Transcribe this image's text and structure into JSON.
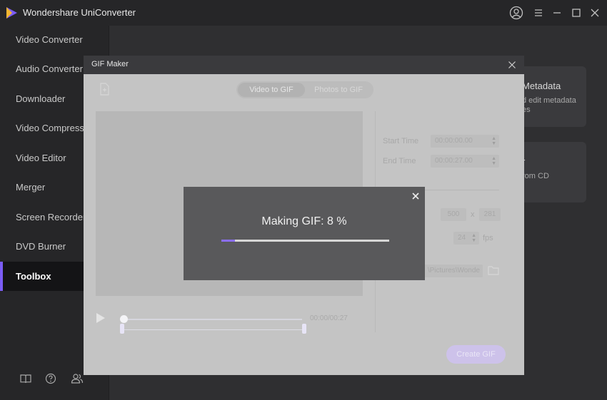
{
  "app": {
    "title": "Wondershare UniConverter",
    "accent": "#7b5cf5"
  },
  "sidebar": {
    "items": [
      {
        "label": "Video Converter",
        "active": false
      },
      {
        "label": "Audio Converter",
        "active": false
      },
      {
        "label": "Downloader",
        "active": false
      },
      {
        "label": "Video Compressor",
        "active": false
      },
      {
        "label": "Video Editor",
        "active": false
      },
      {
        "label": "Merger",
        "active": false
      },
      {
        "label": "Screen Recorder",
        "active": false
      },
      {
        "label": "DVD Burner",
        "active": false
      },
      {
        "label": "Toolbox",
        "active": true
      }
    ],
    "bottom_icons": [
      "book-icon",
      "help-icon",
      "account-icon"
    ]
  },
  "background_cards": [
    {
      "title": "Metadata",
      "text_lines": [
        "d edit metadata",
        "es"
      ]
    },
    {
      "title": "r",
      "text_lines": [
        "rom CD"
      ]
    }
  ],
  "gif_maker": {
    "title": "GIF Maker",
    "tabs": [
      {
        "label": "Video to GIF",
        "selected": true
      },
      {
        "label": "Photos to GIF",
        "selected": false
      }
    ],
    "start_time": {
      "label": "Start Time",
      "value": "00:00:00.00"
    },
    "end_time": {
      "label": "End Time",
      "value": "00:00:27.00"
    },
    "size": {
      "width": "500",
      "separator": "x",
      "height": "281"
    },
    "frame_rate": {
      "value": "24",
      "unit": "fps"
    },
    "output_path": "\\Pictures\\Wonde",
    "timecode": "00:00/00:27",
    "create_label": "Create GIF"
  },
  "progress_popup": {
    "text": "Making GIF: 8 %",
    "progress": 0.08
  }
}
